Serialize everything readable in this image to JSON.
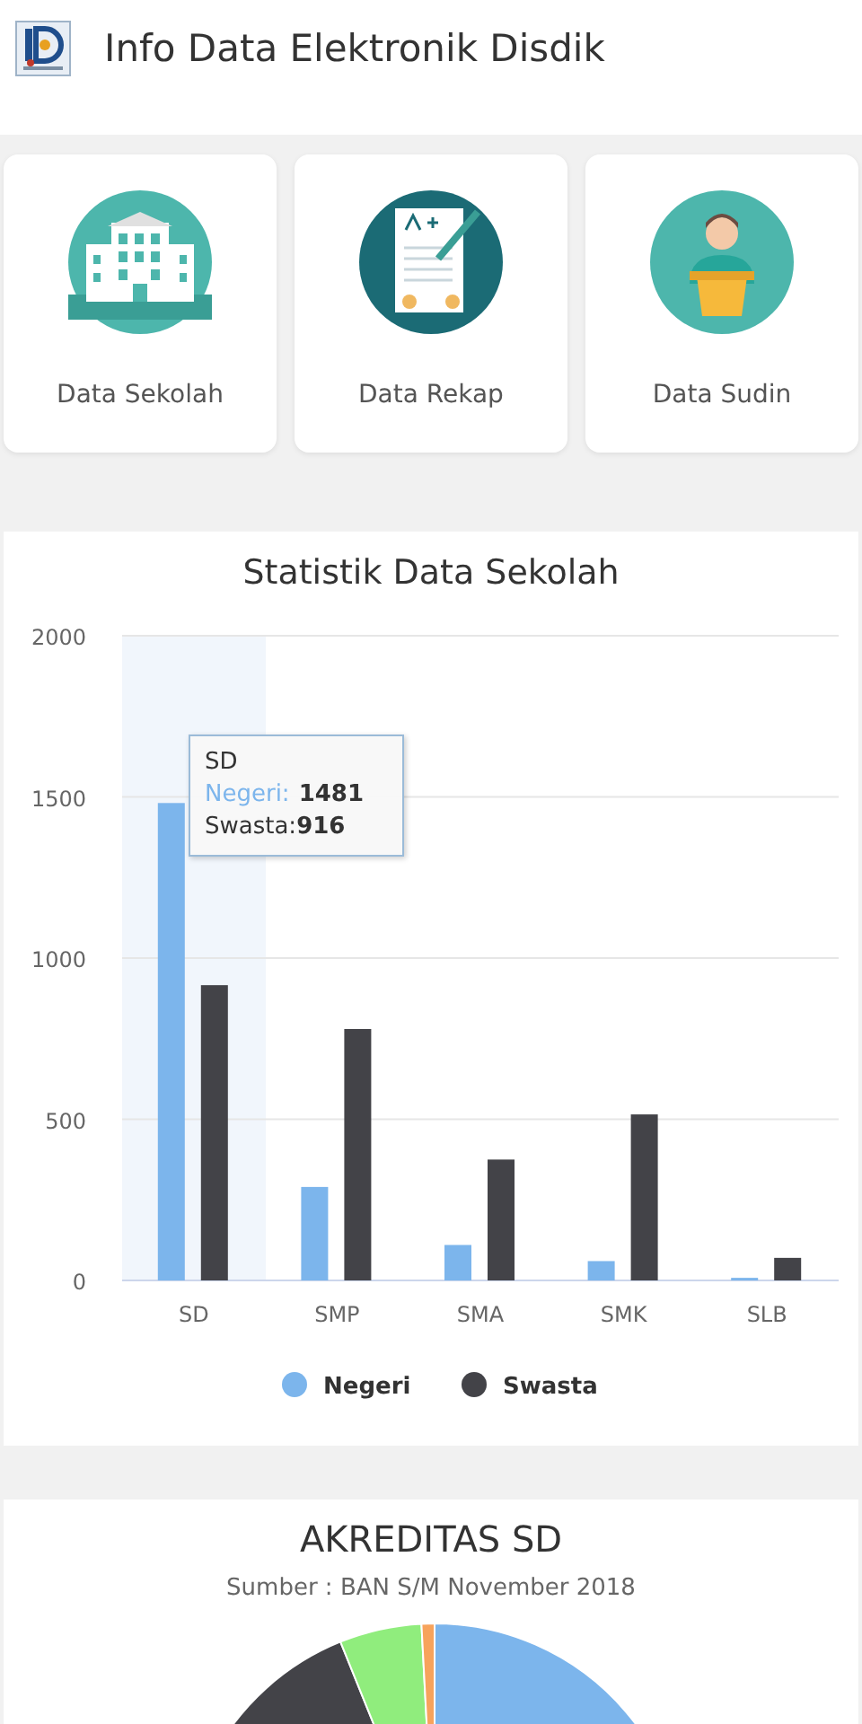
{
  "app_bar": {
    "title": "Info Data Elektronik Disdik"
  },
  "menu": [
    {
      "label": "Data Sekolah",
      "kind": "school"
    },
    {
      "label": "Data Rekap",
      "kind": "report"
    },
    {
      "label": "Data Sudin",
      "kind": "speaker"
    }
  ],
  "school_stats": {
    "title": "Statistik Data Sekolah",
    "tooltip": {
      "title": "SD",
      "lines": [
        {
          "label": "Negeri:",
          "value": "1481"
        },
        {
          "label": "Swasta:",
          "value": "916"
        }
      ]
    },
    "chart_data": {
      "type": "bar",
      "grid": true,
      "legend": "bottom",
      "categories": [
        "SD",
        "SMP",
        "SMA",
        "SMK",
        "SLB"
      ],
      "ylim": [
        0,
        2000
      ],
      "yticks": [
        0,
        500,
        1000,
        1500,
        2000
      ],
      "series": [
        {
          "name": "Negeri",
          "color": "#7cb5ec",
          "values": [
            1481,
            290,
            110,
            60,
            8
          ]
        },
        {
          "name": "Swasta",
          "color": "#434348",
          "values": [
            916,
            780,
            375,
            515,
            70
          ]
        }
      ]
    }
  },
  "accreditation": {
    "title": "AKREDITAS SD",
    "subtitle": "Sumber : BAN S/M November 2018"
  }
}
